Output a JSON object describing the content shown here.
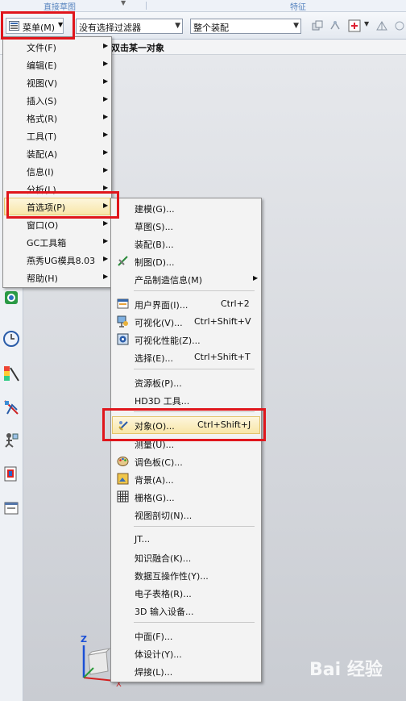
{
  "ribbon": {
    "tabs": [
      "直接草图",
      "特征"
    ]
  },
  "toolbar": {
    "menu_label": "菜单(M)",
    "filter_value": "没有选择过滤器",
    "scope_value": "整个装配"
  },
  "cue_line": "双击某一对象",
  "main_menu": [
    {
      "label": "文件(F)"
    },
    {
      "label": "编辑(E)"
    },
    {
      "label": "视图(V)"
    },
    {
      "label": "插入(S)"
    },
    {
      "label": "格式(R)"
    },
    {
      "label": "工具(T)"
    },
    {
      "label": "装配(A)"
    },
    {
      "label": "信息(I)"
    },
    {
      "label": "分析(L)"
    },
    {
      "label": "首选项(P)"
    },
    {
      "label": "窗口(O)"
    },
    {
      "label": "GC工具箱"
    },
    {
      "label": "燕秀UG模具8.03"
    },
    {
      "label": "帮助(H)"
    }
  ],
  "sub_menu": [
    {
      "label": "建模(G)...",
      "shortcut": ""
    },
    {
      "label": "草图(S)...",
      "shortcut": ""
    },
    {
      "label": "装配(B)...",
      "shortcut": ""
    },
    {
      "label": "制图(D)...",
      "shortcut": ""
    },
    {
      "label": "产品制造信息(M)",
      "shortcut": ""
    },
    {
      "label": "用户界面(I)...",
      "shortcut": "Ctrl+2"
    },
    {
      "label": "可视化(V)...",
      "shortcut": "Ctrl+Shift+V"
    },
    {
      "label": "可视化性能(Z)...",
      "shortcut": ""
    },
    {
      "label": "选择(E)...",
      "shortcut": "Ctrl+Shift+T"
    },
    {
      "label": "资源板(P)...",
      "shortcut": ""
    },
    {
      "label": "HD3D 工具...",
      "shortcut": ""
    },
    {
      "label": "对象(O)...",
      "shortcut": "Ctrl+Shift+J"
    },
    {
      "label": "测量(U)...",
      "shortcut": ""
    },
    {
      "label": "调色板(C)...",
      "shortcut": ""
    },
    {
      "label": "背景(A)...",
      "shortcut": ""
    },
    {
      "label": "栅格(G)...",
      "shortcut": ""
    },
    {
      "label": "视图剖切(N)...",
      "shortcut": ""
    },
    {
      "label": "JT...",
      "shortcut": ""
    },
    {
      "label": "知识融合(K)...",
      "shortcut": ""
    },
    {
      "label": "数据互操作性(Y)...",
      "shortcut": ""
    },
    {
      "label": "电子表格(R)...",
      "shortcut": ""
    },
    {
      "label": "3D 输入设备...",
      "shortcut": ""
    },
    {
      "label": "中面(F)...",
      "shortcut": ""
    },
    {
      "label": "体设计(Y)...",
      "shortcut": ""
    },
    {
      "label": "焊接(L)...",
      "shortcut": ""
    }
  ],
  "triad": {
    "z": "Z",
    "x": "X"
  },
  "watermark": "Bai 经验",
  "colors": {
    "highlight_border": "#e0161c",
    "hover_fill": "#f8e6a8"
  }
}
